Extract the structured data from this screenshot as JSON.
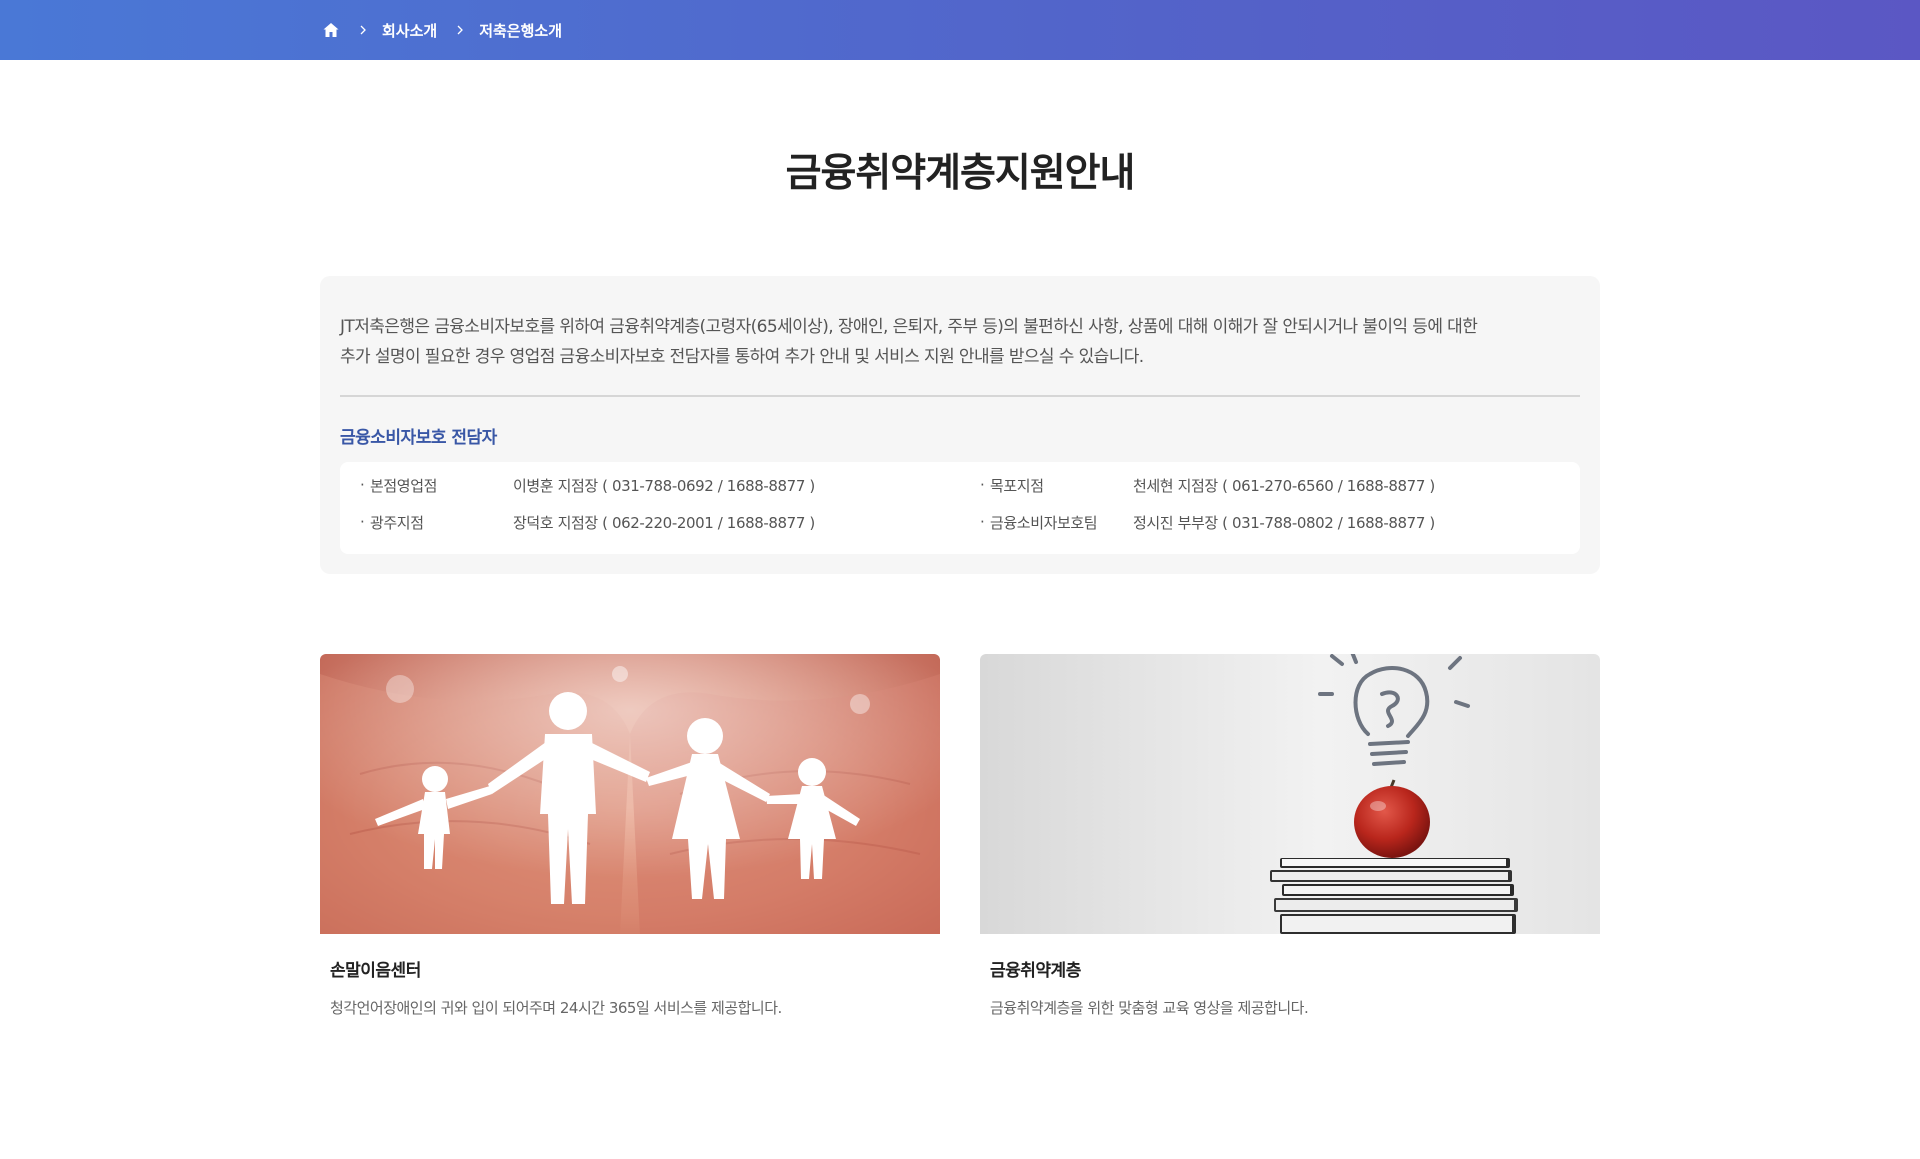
{
  "breadcrumb": {
    "home_icon": "home-icon",
    "items": [
      "회사소개",
      "저축은행소개"
    ]
  },
  "page": {
    "title": "금융취약계층지원안내"
  },
  "info": {
    "description_line1": "JT저축은행은 금융소비자보호를 위하여 금융취약계층(고령자(65세이상), 장애인, 은퇴자, 주부 등)의 불편하신 사항, 상품에 대해 이해가 잘 안되시거나 불이익 등에 대한",
    "description_line2": "추가 설명이 필요한 경우 영업점 금융소비자보호 전담자를 통하여 추가 안내 및 서비스 지원 안내를 받으실 수 있습니다.",
    "subtitle": "금융소비자보호 전담자",
    "contacts": [
      {
        "bullet": "·",
        "branch": "본점영업점",
        "detail": "이병훈 지점장 ( 031-788-0692 / 1688-8877 )"
      },
      {
        "bullet": "·",
        "branch": "목포지점",
        "detail": "천세현 지점장 ( 061-270-6560 / 1688-8877 )"
      },
      {
        "bullet": "·",
        "branch": "광주지점",
        "detail": "장덕호 지점장 ( 062-220-2001 / 1688-8877 )"
      },
      {
        "bullet": "·",
        "branch": "금융소비자보호팀",
        "detail": "정시진 부부장 ( 031-788-0802 / 1688-8877 )"
      }
    ]
  },
  "cards": [
    {
      "title": "손말이음센터",
      "description": "청각언어장애인의 귀와 입이 되어주며 24시간 365일 서비스를 제공합니다."
    },
    {
      "title": "금융취약계층",
      "description": "금융취약계층을 위한 맞춤형 교육 영상을 제공합니다."
    }
  ],
  "colors": {
    "header_gradient_start": "#4a78d6",
    "header_gradient_end": "#5b57c4",
    "subtitle_blue": "#3957a6",
    "info_box_bg": "#f6f6f6"
  }
}
